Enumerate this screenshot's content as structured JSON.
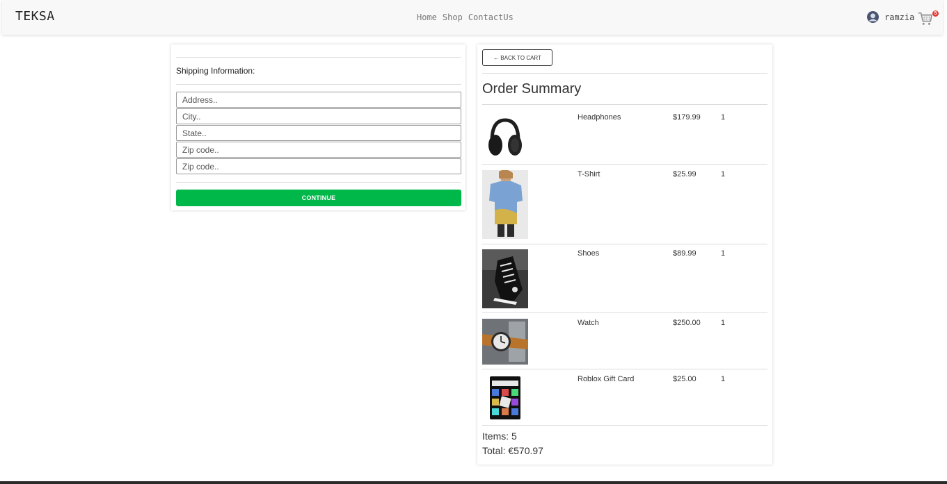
{
  "brand": "TEKSA",
  "nav": {
    "home": "Home",
    "shop": "Shop",
    "contact": "ContactUs"
  },
  "user": {
    "name": "ramzia"
  },
  "cart": {
    "count": "5"
  },
  "shipping": {
    "title": "Shipping Information:",
    "address_placeholder": "Address..",
    "city_placeholder": "City..",
    "state_placeholder": "State..",
    "zip_placeholder": "Zip code..",
    "zip2_placeholder": "Zip code..",
    "continue_label": "CONTINUE"
  },
  "order": {
    "back_label": "← BACK TO CART",
    "title": "Order Summary",
    "items": [
      {
        "name": "Headphones",
        "price": "$179.99",
        "qty": "1"
      },
      {
        "name": "T-Shirt",
        "price": "$25.99",
        "qty": "1"
      },
      {
        "name": "Shoes",
        "price": "$89.99",
        "qty": "1"
      },
      {
        "name": "Watch",
        "price": "$250.00",
        "qty": "1"
      },
      {
        "name": "Roblox Gift Card",
        "price": "$25.00",
        "qty": "1"
      }
    ],
    "items_count": "Items: 5",
    "total": "Total: €570.97"
  },
  "colors": {
    "accent": "#00b74a",
    "badge": "#e53935"
  }
}
